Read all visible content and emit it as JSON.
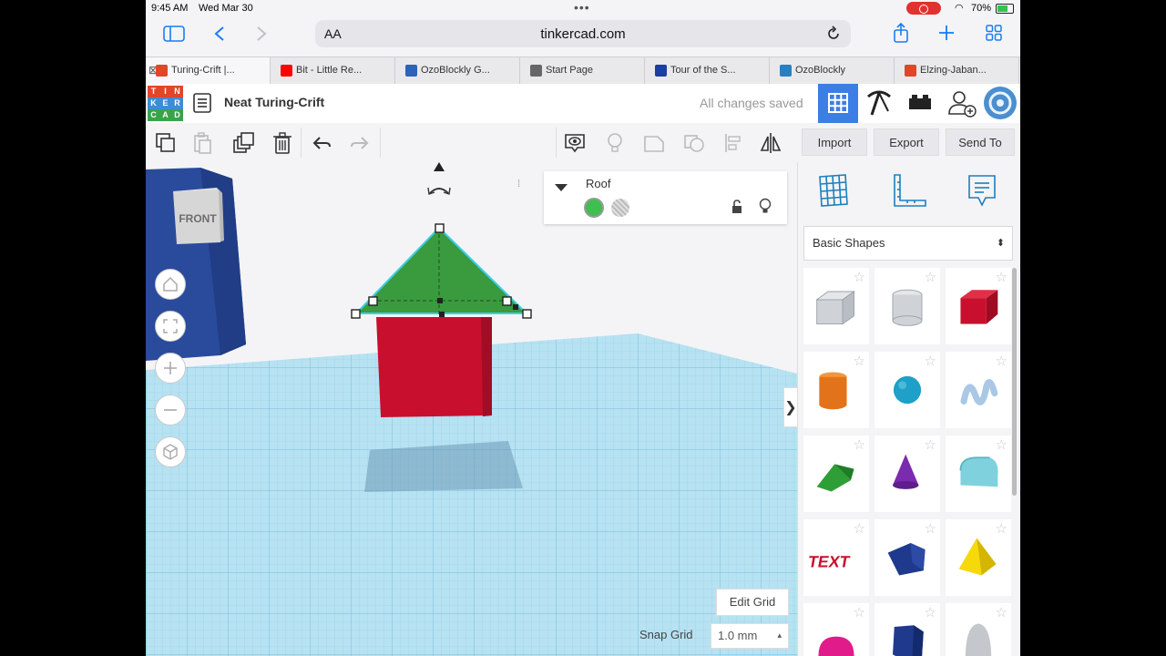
{
  "status_bar": {
    "time": "9:45 AM",
    "date": "Wed Mar 30",
    "battery": "70%"
  },
  "browser": {
    "address_prefix": "AA",
    "url": "tinkercad.com",
    "tabs": [
      {
        "label": "Turing-Crift |...",
        "favicon_color": "#e2452a",
        "active": true
      },
      {
        "label": "Bit - Little Re...",
        "favicon_color": "#ff0000",
        "active": false
      },
      {
        "label": "OzoBlockly G...",
        "favicon_color": "#2e63b8",
        "active": false
      },
      {
        "label": "Start Page",
        "favicon_color": "#666666",
        "active": false
      },
      {
        "label": "Tour of the S...",
        "favicon_color": "#1a3fa0",
        "active": false
      },
      {
        "label": "OzoBlockly",
        "favicon_color": "#2a7fc1",
        "active": false
      },
      {
        "label": "Elzing-Jaban...",
        "favicon_color": "#e2452a",
        "active": false
      }
    ]
  },
  "tinkercad": {
    "logo_letters": [
      "T",
      "I",
      "N",
      "K",
      "E",
      "R",
      "C",
      "A",
      "D"
    ],
    "design_title": "Neat Turing-Crift",
    "save_status": "All changes saved",
    "actions": {
      "import": "Import",
      "export": "Export",
      "send_to": "Send To"
    },
    "view_cube_label": "FRONT",
    "inspector": {
      "shape_name": "Roof",
      "color": "#3fbf4f"
    },
    "shape_library": "Basic Shapes",
    "shapes": [
      "Box Hole",
      "Cylinder Hole",
      "Box",
      "Cylinder",
      "Sphere",
      "Scribble",
      "Roof",
      "Cone",
      "Round Roof",
      "Text",
      "Polygon",
      "Pyramid",
      "Half Sphere",
      "Hexagonal Prism",
      "Paraboloid"
    ],
    "edit_grid": "Edit Grid",
    "snap_grid_label": "Snap Grid",
    "snap_grid_value": "1.0 mm"
  },
  "colors": {
    "accent_blue": "#3c7ee6",
    "box_red": "#c8102e",
    "roof_green": "#3a9a3e",
    "grid_blue": "#a9dcef"
  }
}
